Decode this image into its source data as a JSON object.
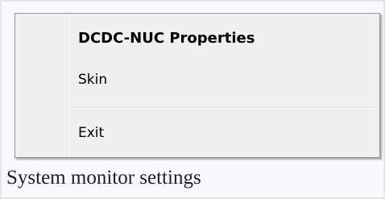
{
  "context_menu": {
    "items": [
      {
        "label": "DCDC-NUC Properties",
        "default": true
      },
      {
        "label": "Skin"
      },
      {
        "label": "Exit"
      }
    ]
  },
  "caption": {
    "text": "System monitor settings"
  }
}
